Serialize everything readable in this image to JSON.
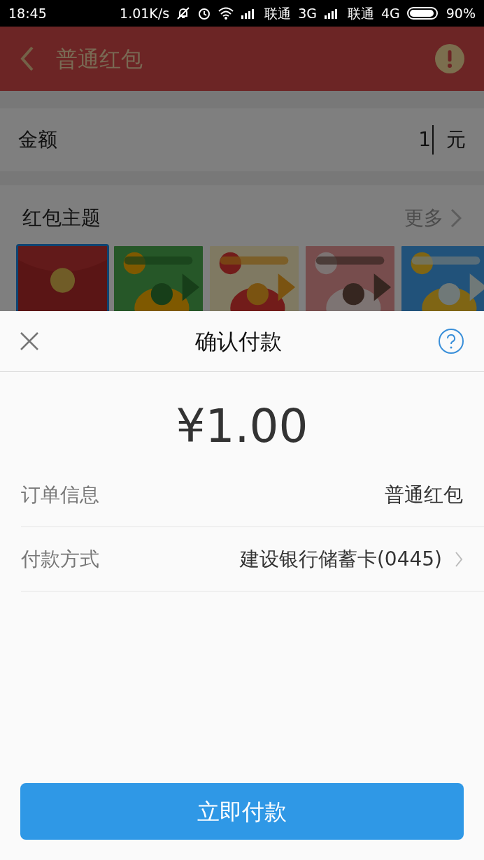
{
  "status_bar": {
    "time": "18:45",
    "speed": "1.01K/s",
    "carriers": [
      {
        "name": "联通",
        "network": "3G"
      },
      {
        "name": "联通",
        "network": "4G"
      }
    ],
    "battery": "90%"
  },
  "header": {
    "title": "普通红包"
  },
  "amount_field": {
    "label": "金额",
    "value": "1",
    "unit": "元"
  },
  "themes": {
    "title": "红包主题",
    "more": "更多",
    "items": [
      {
        "kind": "envelope",
        "selected": true
      },
      {
        "kind": "picture",
        "selected": false
      },
      {
        "kind": "picture",
        "selected": false
      },
      {
        "kind": "picture",
        "selected": false
      },
      {
        "kind": "picture",
        "selected": false
      }
    ]
  },
  "dialog": {
    "title": "确认付款",
    "amount": "¥1.00",
    "rows": [
      {
        "kind": "plain",
        "label": "订单信息",
        "value": "普通红包"
      },
      {
        "kind": "link",
        "label": "付款方式",
        "value": "建设银行储蓄卡(0445)"
      }
    ],
    "button": "立即付款"
  }
}
